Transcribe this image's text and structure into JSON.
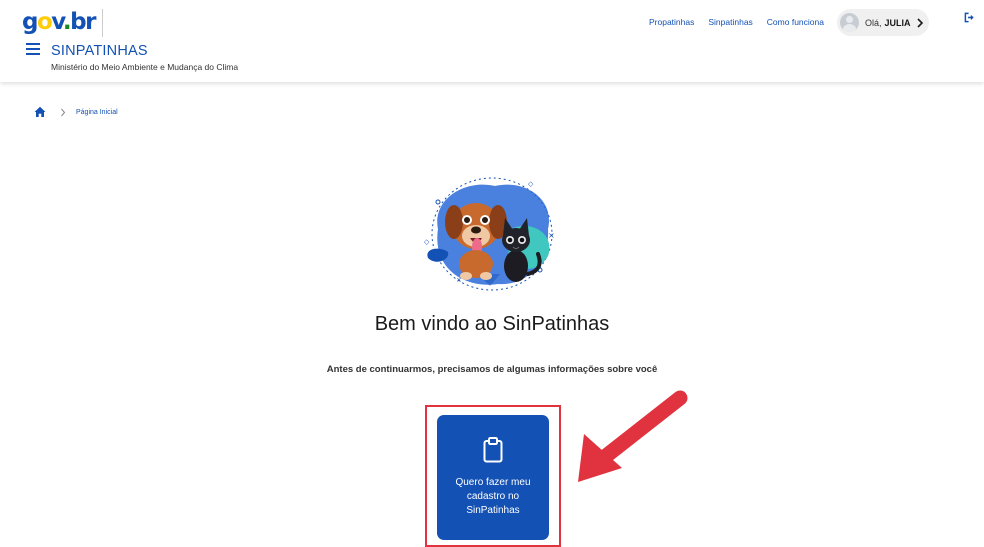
{
  "header": {
    "logo_text": {
      "g": "g",
      "o": "o",
      "v": "v",
      "dot": ".",
      "br": "br"
    },
    "system_title": "SINPATINHAS",
    "system_subtitle": "Ministério do Meio Ambiente e Mudança do Clima",
    "nav_links": [
      "Propatinhas",
      "Sinpatinhas",
      "Como funciona"
    ],
    "user": {
      "greeting": "Olá,",
      "name": "JULIA"
    }
  },
  "breadcrumb": {
    "current": "Página Inicial"
  },
  "main": {
    "welcome_title": "Bem vindo ao SinPatinhas",
    "lead_text": "Antes de continuarmos, precisamos de algumas informações sobre você",
    "register_card": {
      "label": "Quero fazer meu cadastro no SinPatinhas"
    }
  },
  "colors": {
    "primary": "#1351b4",
    "highlight": "#e0333f",
    "brand_yellow": "#ffcd07",
    "brand_green": "#168821"
  },
  "icons": [
    "menu-icon",
    "user-avatar-icon",
    "chevron-right-icon",
    "logout-icon",
    "home-icon",
    "clipboard-icon",
    "pets-illustration",
    "red-arrow-annotation"
  ]
}
